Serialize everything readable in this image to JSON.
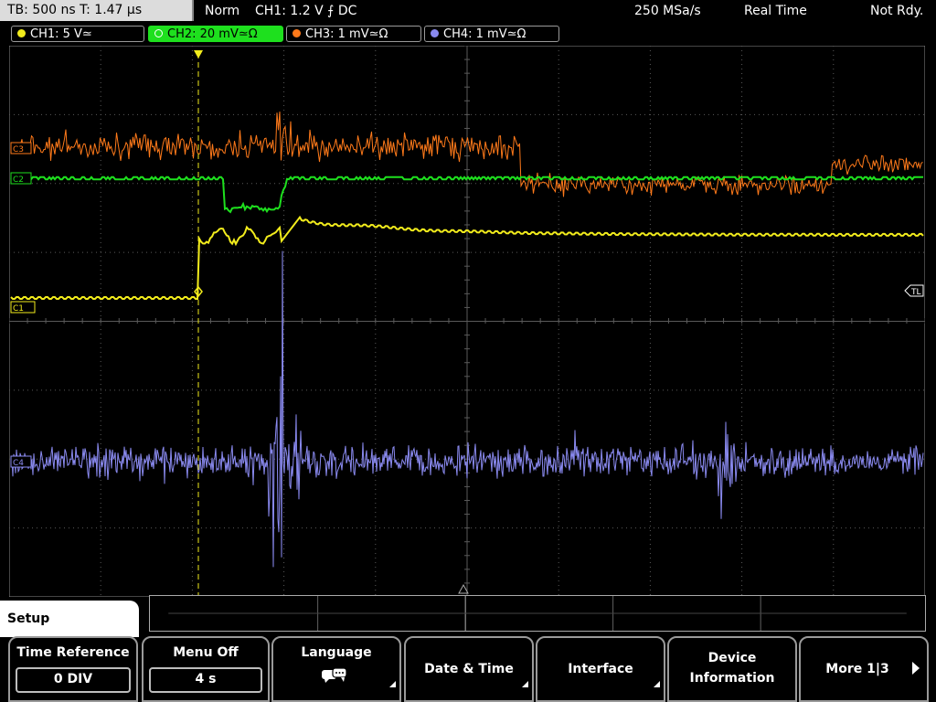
{
  "status": {
    "timebase": "TB: 500 ns   T: 1.47 µs",
    "trigger_mode": "Norm",
    "trigger_info": "CH1: 1.2 V ⨍ DC",
    "sample_rate": "250 MSa/s",
    "acq_mode": "Real Time",
    "state": "Not Rdy."
  },
  "channels": [
    {
      "label": "CH1: 5 V≃",
      "color": "#f2ec1c",
      "active": false
    },
    {
      "label": "CH2: 20 mV≃Ω",
      "color": "#1ee01e",
      "active": true
    },
    {
      "label": "CH3: 1 mV≃Ω",
      "color": "#ff7a1a",
      "active": false
    },
    {
      "label": "CH4: 1 mV≃Ω",
      "color": "#8a8af0",
      "active": false
    }
  ],
  "markers": {
    "ch1": "C1",
    "ch2": "C2",
    "ch3": "C3",
    "ch4": "C4",
    "trigger_level": "TL"
  },
  "menu": {
    "title": "Setup",
    "softkeys": [
      {
        "label": "Time Reference",
        "value": "0 DIV"
      },
      {
        "label": "Menu Off",
        "value": "4 s"
      },
      {
        "label": "Language",
        "icon": "speech-bubble-icon",
        "submenu": true
      },
      {
        "label": "Date & Time",
        "submenu": true
      },
      {
        "label": "Interface",
        "submenu": true
      },
      {
        "label_line1": "Device",
        "label_line2": "Information"
      },
      {
        "label": "More 1|3",
        "icon": "arrow-right-icon"
      }
    ]
  },
  "colors": {
    "ch1": "#f2ec1c",
    "ch2": "#1ee01e",
    "ch3": "#ff7a1a",
    "ch4": "#8a8af0",
    "grid": "#5a5a5a",
    "trigger_cursor": "#f2ec1c"
  }
}
